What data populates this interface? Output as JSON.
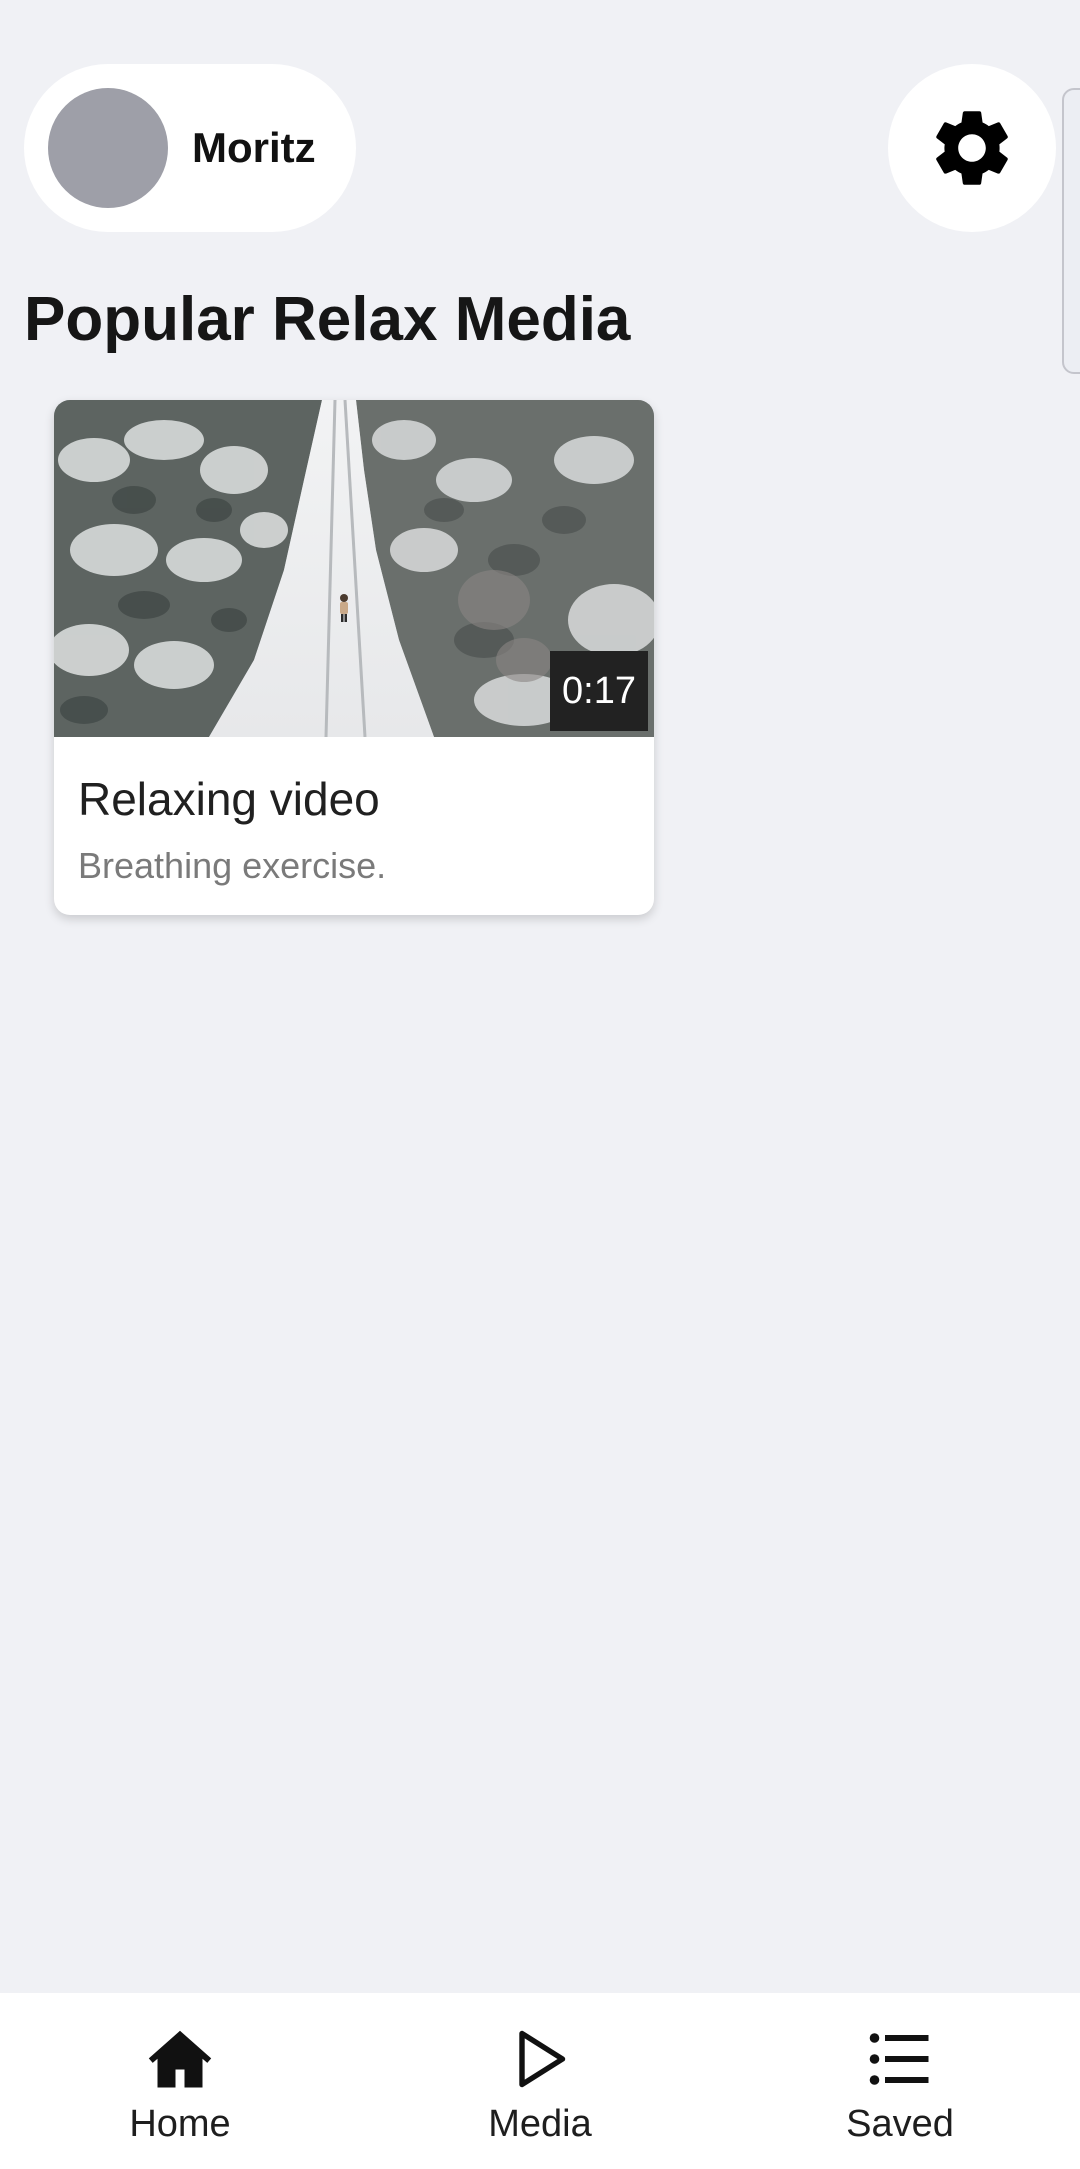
{
  "header": {
    "user_name": "Moritz",
    "avatar_color": "#9e9fa8"
  },
  "section": {
    "title": "Popular Relax Media"
  },
  "media_cards": [
    {
      "title": "Relaxing video",
      "subtitle": "Breathing exercise.",
      "duration": "0:17"
    }
  ],
  "bottom_nav": {
    "items": [
      {
        "label": "Home",
        "icon": "home-icon"
      },
      {
        "label": "Media",
        "icon": "play-icon"
      },
      {
        "label": "Saved",
        "icon": "list-icon"
      }
    ]
  },
  "colors": {
    "background": "#f0f1f5",
    "surface": "#ffffff",
    "text_primary": "#161616",
    "text_secondary": "#7a7a7a",
    "badge_background": "#222222"
  }
}
